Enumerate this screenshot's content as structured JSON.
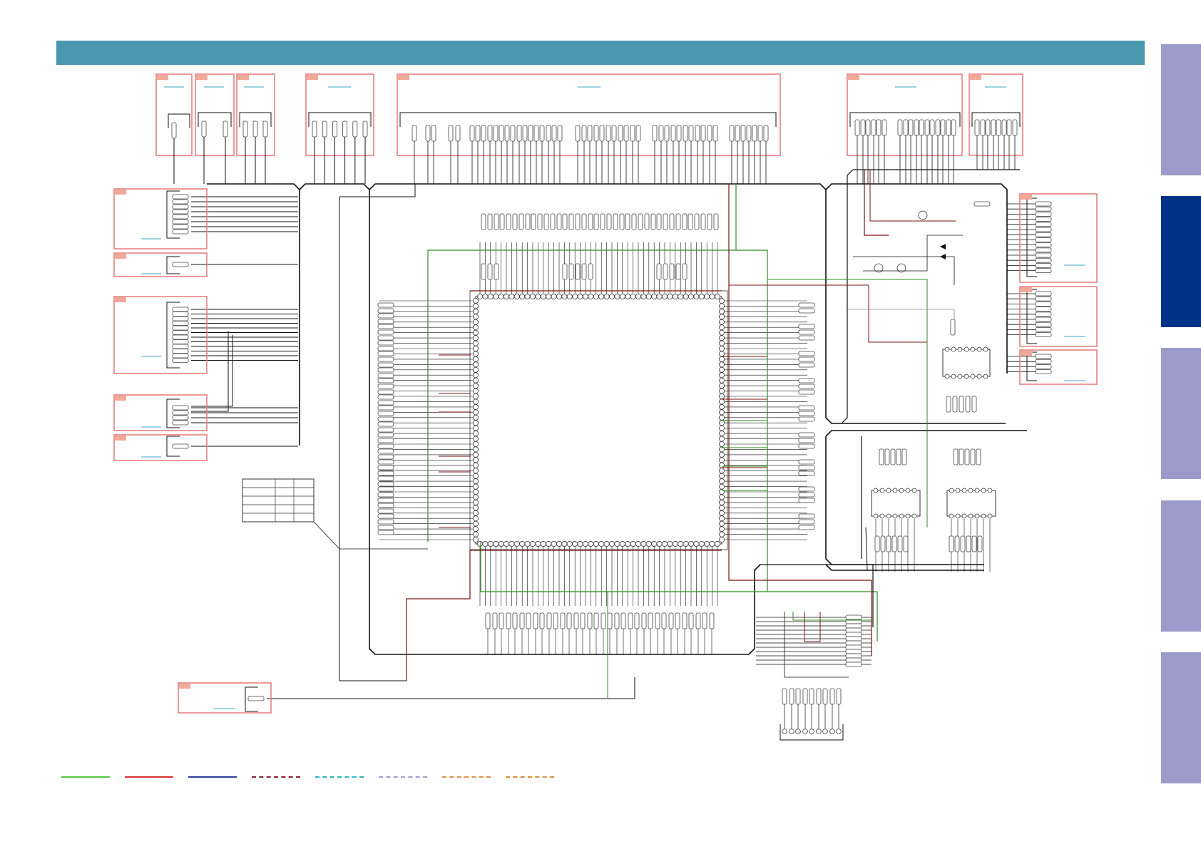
{
  "colors": {
    "header": "#4a98ae",
    "tab_inactive": "#9b9bc9",
    "tab_active": "#003388",
    "block_border": "#e88080",
    "block_tag": "#f0a898",
    "link": "#3aa6cc",
    "wire": "#111111",
    "net_green": "#2e8b1e",
    "net_darkred": "#7a1010"
  },
  "side_tabs": [
    {
      "id": "tab-1",
      "active": false
    },
    {
      "id": "tab-2",
      "active": true
    },
    {
      "id": "tab-3",
      "active": false
    },
    {
      "id": "tab-4",
      "active": false
    },
    {
      "id": "tab-5",
      "active": false
    }
  ],
  "legend": [
    {
      "color": "#5ac83c",
      "style": "solid"
    },
    {
      "color": "#d83030",
      "style": "solid"
    },
    {
      "color": "#2840a0",
      "style": "solid"
    },
    {
      "color": "#902030",
      "style": "dashed"
    },
    {
      "color": "#30b0c8",
      "style": "dashed"
    },
    {
      "color": "#a898d8",
      "style": "dashed"
    },
    {
      "color": "#e09040",
      "style": "dashed"
    },
    {
      "color": "#e08838",
      "style": "dashed"
    }
  ]
}
